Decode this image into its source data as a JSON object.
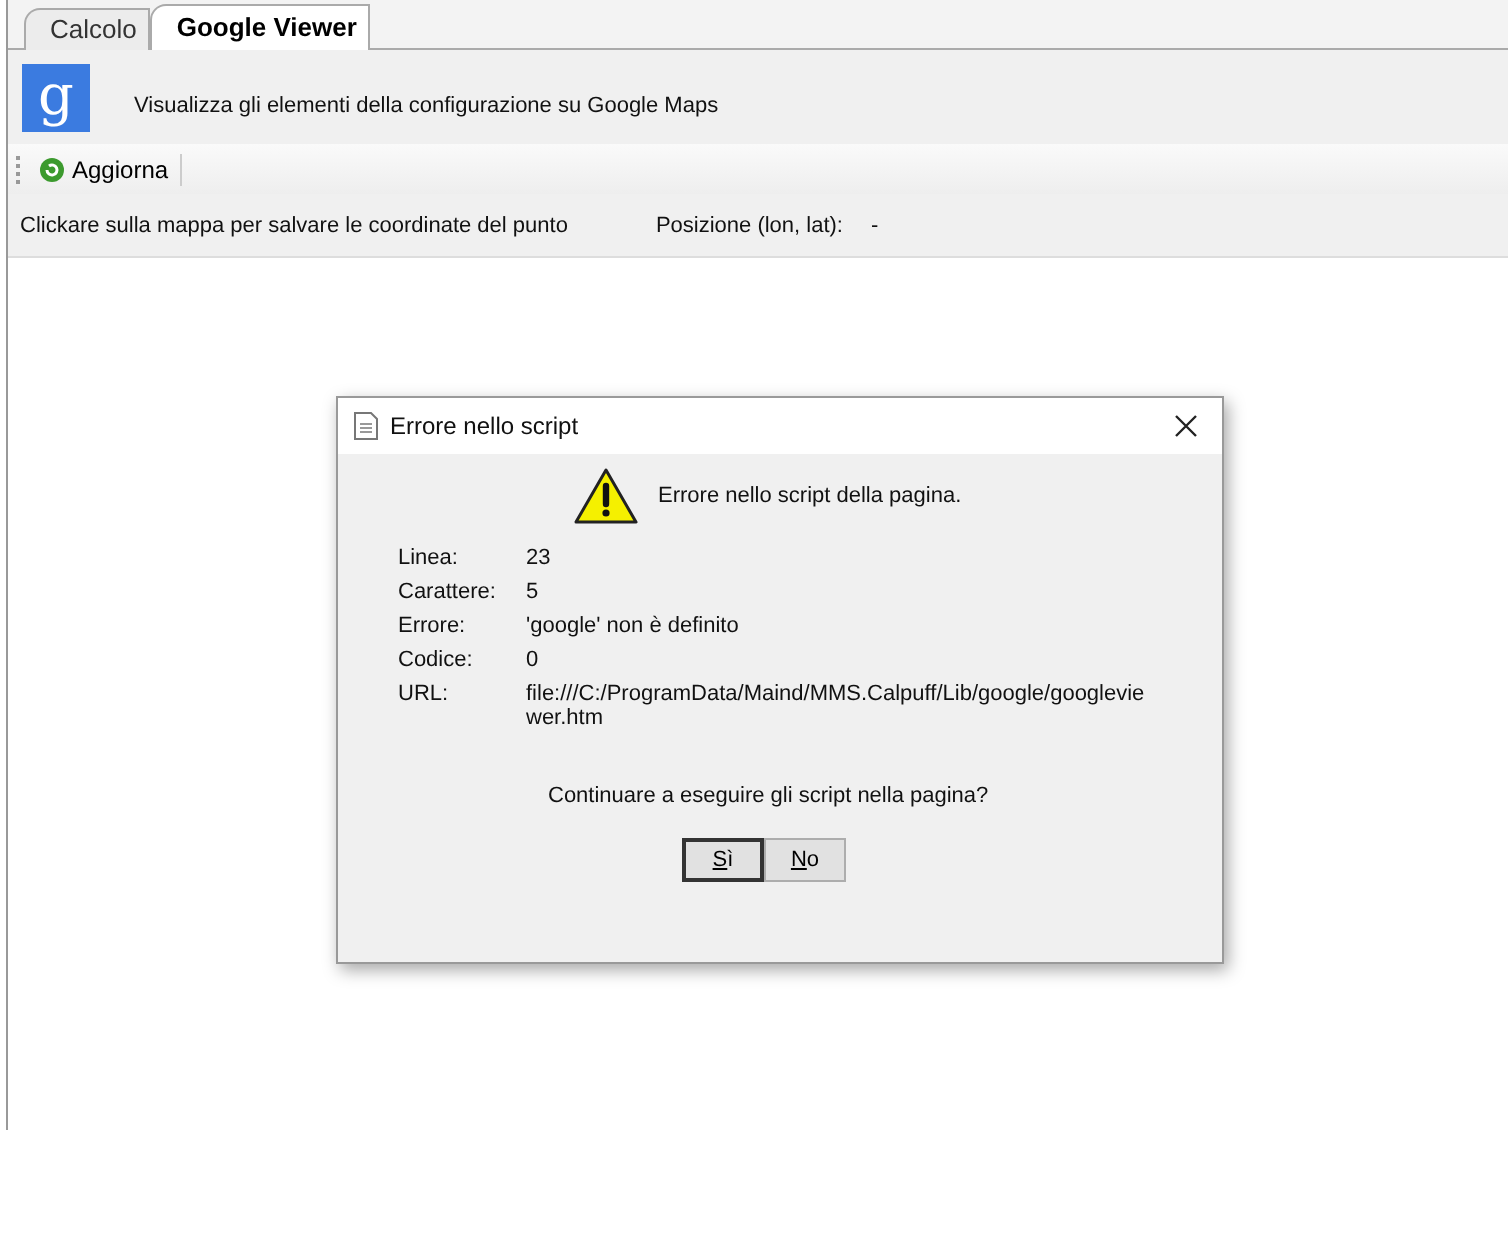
{
  "tabs": [
    {
      "label": "Calcolo",
      "selected": false
    },
    {
      "label": "Google Viewer",
      "selected": true
    }
  ],
  "header": {
    "logo_letter": "g",
    "description": "Visualizza gli elementi della configurazione su Google Maps"
  },
  "toolbar": {
    "buttons": [
      {
        "label": "Aggiorna"
      }
    ]
  },
  "info_bar": {
    "hint": "Clickare sulla mappa per salvare le coordinate del punto",
    "position_label": "Posizione (lon, lat):",
    "position_value": "-"
  },
  "dialog": {
    "title": "Errore nello script",
    "message": "Errore nello script della pagina.",
    "details": [
      {
        "label": "Linea:",
        "value": "23"
      },
      {
        "label": "Carattere:",
        "value": "5"
      },
      {
        "label": "Errore:",
        "value": "'google' non è definito"
      },
      {
        "label": "Codice:",
        "value": "0"
      },
      {
        "label": "URL:",
        "value": "file:///C:/ProgramData/Maind/MMS.Calpuff/Lib/google/googleviewer.htm"
      }
    ],
    "question": "Continuare a eseguire gli script nella pagina?",
    "buttons": [
      {
        "label": "Sì",
        "default": true
      },
      {
        "label": "No",
        "default": false
      }
    ]
  }
}
